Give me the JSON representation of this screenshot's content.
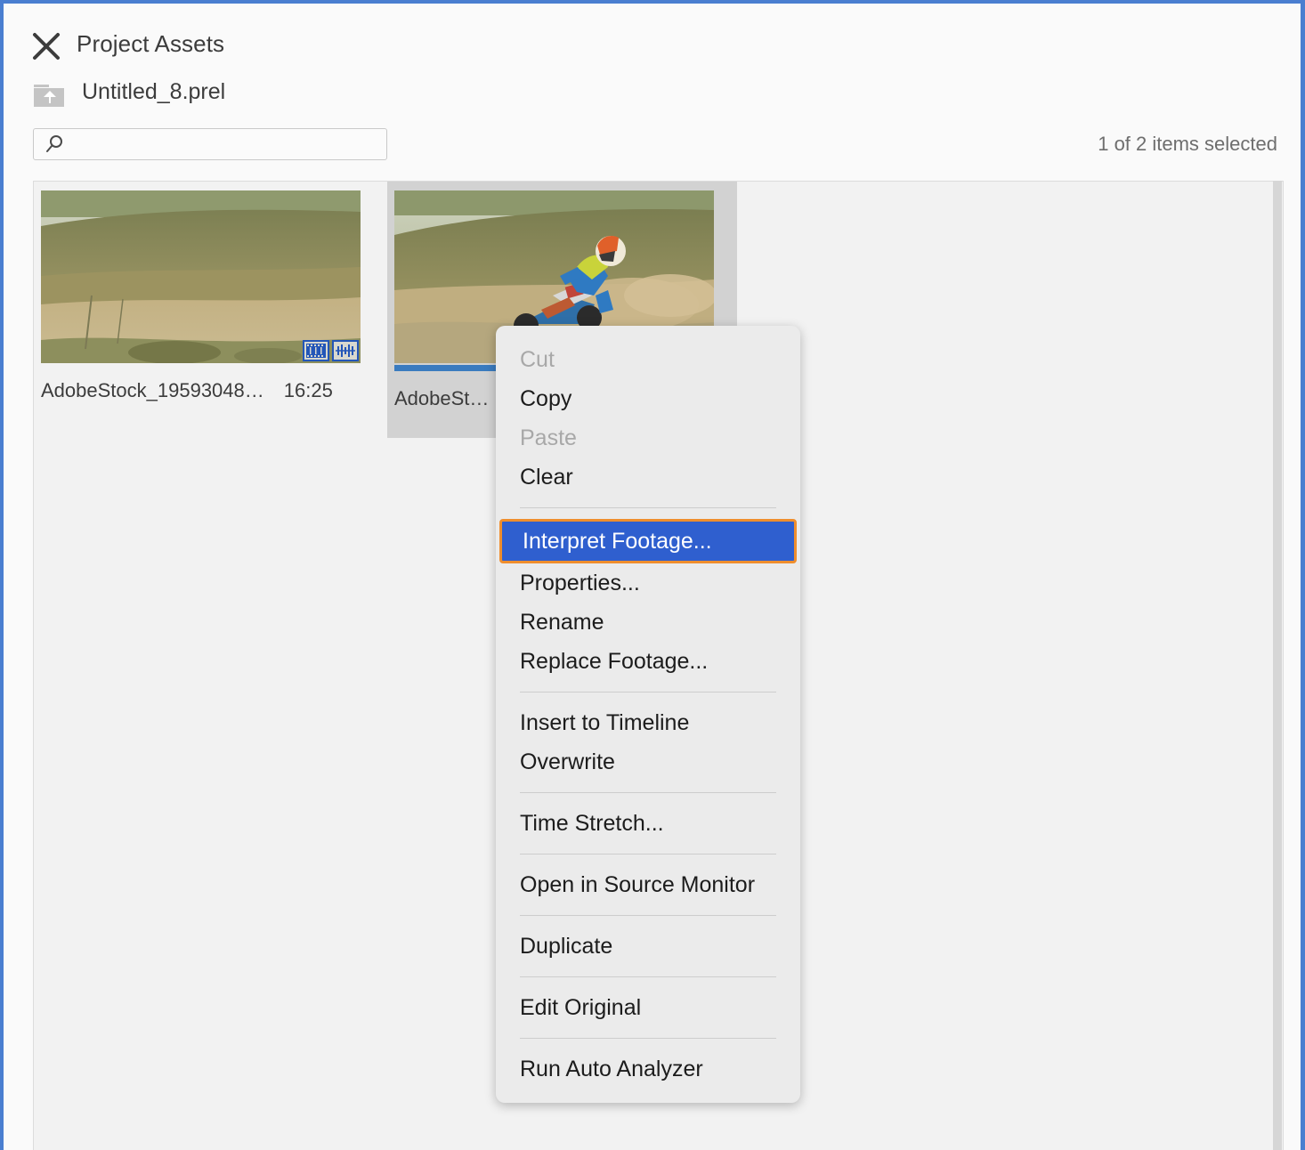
{
  "window": {
    "border_color": "#4a7ed0"
  },
  "header": {
    "close_icon": "close-icon",
    "title": "Project Assets",
    "project_icon": "folder-up-icon",
    "project_name": "Untitled_8.prel"
  },
  "search": {
    "icon": "search-icon",
    "value": "",
    "placeholder": ""
  },
  "status": {
    "selection_count": "1 of 2 items selected"
  },
  "assets": [
    {
      "name": "AdobeStock_19593048…",
      "duration": "16:25",
      "selected": false,
      "badges": [
        "video-filmstrip-icon",
        "audio-waveform-icon"
      ],
      "has_progress_bar": false
    },
    {
      "name": "AdobeSt…",
      "duration": "",
      "selected": true,
      "badges": [],
      "has_progress_bar": true
    }
  ],
  "context_menu": {
    "highlight_bg": "#2f5fcf",
    "highlight_border": "#ef8e2d",
    "items": [
      {
        "label": "Cut",
        "state": "disabled"
      },
      {
        "label": "Copy",
        "state": "normal"
      },
      {
        "label": "Paste",
        "state": "disabled"
      },
      {
        "label": "Clear",
        "state": "normal"
      },
      {
        "label": "__separator__",
        "state": "separator"
      },
      {
        "label": "Interpret Footage...",
        "state": "highlighted"
      },
      {
        "label": "Properties...",
        "state": "normal"
      },
      {
        "label": "Rename",
        "state": "normal"
      },
      {
        "label": "Replace Footage...",
        "state": "normal"
      },
      {
        "label": "__separator__",
        "state": "separator"
      },
      {
        "label": "Insert to Timeline",
        "state": "normal"
      },
      {
        "label": "Overwrite",
        "state": "normal"
      },
      {
        "label": "__separator__",
        "state": "separator"
      },
      {
        "label": "Time Stretch...",
        "state": "normal"
      },
      {
        "label": "__separator__",
        "state": "separator"
      },
      {
        "label": "Open in Source Monitor",
        "state": "normal"
      },
      {
        "label": "__separator__",
        "state": "separator"
      },
      {
        "label": "Duplicate",
        "state": "normal"
      },
      {
        "label": "__separator__",
        "state": "separator"
      },
      {
        "label": "Edit Original",
        "state": "normal"
      },
      {
        "label": "__separator__",
        "state": "separator"
      },
      {
        "label": "Run Auto Analyzer",
        "state": "normal"
      }
    ]
  }
}
